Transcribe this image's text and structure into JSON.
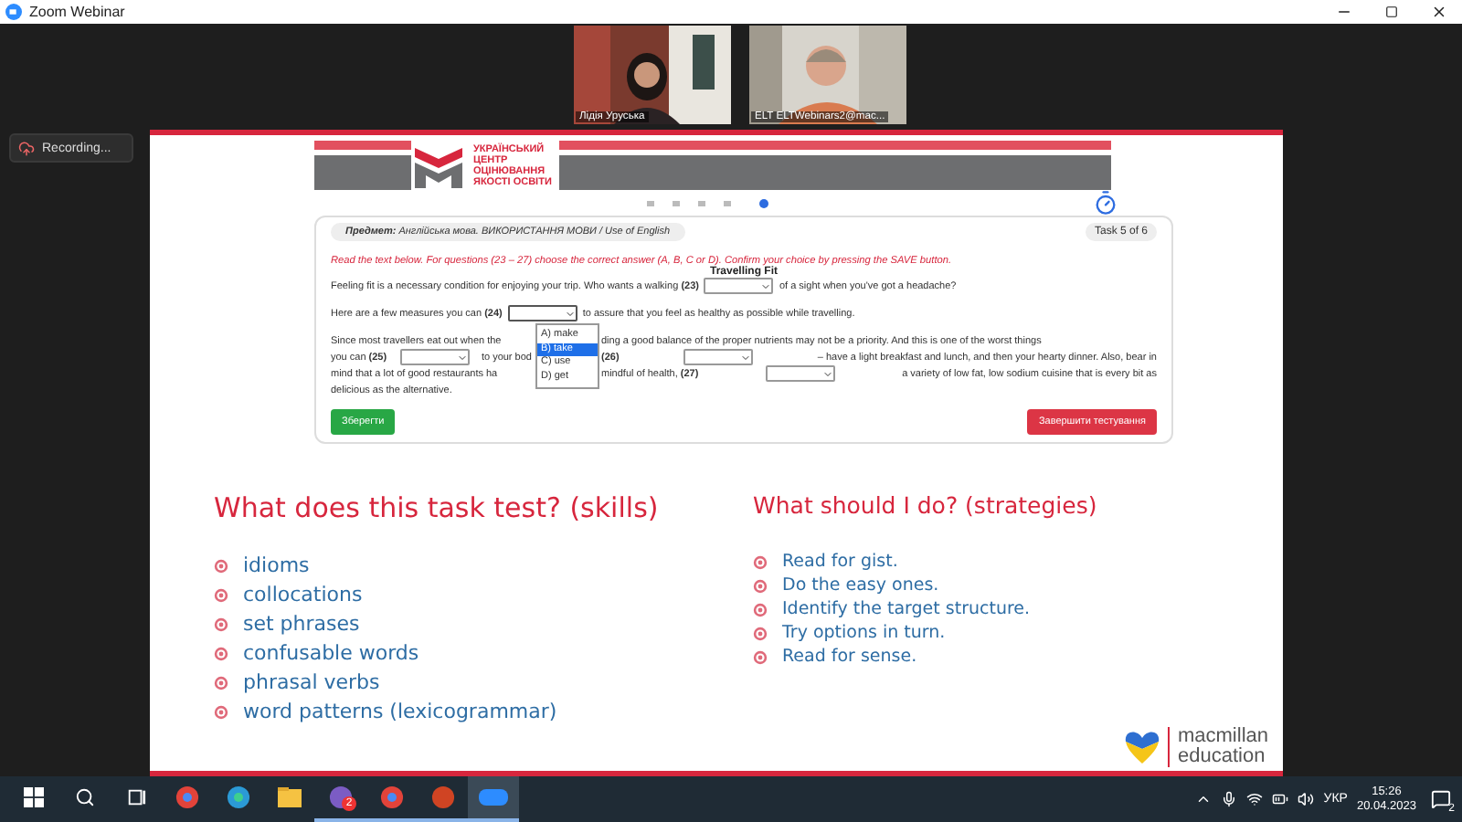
{
  "window": {
    "title": "Zoom Webinar"
  },
  "participants": [
    {
      "name": "Лідія Уруська"
    },
    {
      "name": "ELT ELTWebinars2@mac..."
    }
  ],
  "recording": {
    "label": "Recording..."
  },
  "slide": {
    "logo_lines": [
      "УКРАЇНСЬКИЙ",
      "ЦЕНТР",
      "ОЦІНЮВАННЯ",
      "ЯКОСТІ ОСВІТИ"
    ],
    "test": {
      "subject": "**Предмет:** Англійська мова. ВИКОРИСТАННЯ МОВИ / Use of English",
      "counter": "Task 5 of 6",
      "instruction": "Read the text below. For questions (23 – 27) choose the correct answer (A, B, C or D). Confirm your choice by pressing the SAVE button.",
      "heading": "Travelling Fit",
      "paragraphs": [
        [
          {
            "kind": "text",
            "text": "Feeling fit is a necessary condition for enjoying your trip. Who wants a walking **(23)**"
          },
          {
            "kind": "select",
            "open": false
          },
          {
            "kind": "text",
            "text": "of a sight when you've got a headache?"
          }
        ],
        [
          {
            "kind": "text",
            "text": "Here are a few measures you can **(24)**"
          },
          {
            "kind": "select",
            "open": true,
            "options": [
              {
                "label": "A) make",
                "selected": false
              },
              {
                "label": "B) take",
                "selected": true
              },
              {
                "label": "C) use",
                "selected": false
              },
              {
                "label": "D) get",
                "selected": false
              }
            ]
          },
          {
            "kind": "text",
            "text": "to assure that you feel as healthy as possible while travelling."
          }
        ]
      ],
      "covered_paragraph": [
        {
          "before": [
            {
              "kind": "text",
              "text": "Since most travellers eat out when the"
            }
          ],
          "after": [
            {
              "kind": "text",
              "text": "ding a good balance of the proper nutrients may not be a priority. And this is one of the worst things"
            }
          ]
        },
        {
          "before": [
            {
              "kind": "text",
              "text": "you can **(25)**"
            },
            {
              "kind": "select",
              "open": false
            },
            {
              "kind": "text",
              "text": "to your bod"
            }
          ],
          "after": [
            {
              "kind": "text",
              "text": "**(26)**"
            },
            {
              "kind": "select",
              "open": false
            },
            {
              "kind": "text",
              "text": "– have a light breakfast and lunch, and then your hearty dinner. Also, bear in"
            }
          ]
        },
        {
          "before": [
            {
              "kind": "text",
              "text": "mind that a lot of good restaurants ha"
            }
          ],
          "after": [
            {
              "kind": "text",
              "text": "mindful of health, **(27)**"
            },
            {
              "kind": "select",
              "open": false
            },
            {
              "kind": "text",
              "text": "a variety of low fat, low sodium cuisine that is every bit as"
            }
          ]
        },
        {
          "before": [
            {
              "kind": "text",
              "text": "delicious as the alternative."
            }
          ]
        }
      ],
      "save_button": "Зберегти",
      "finish_button": "Завершити тестування"
    },
    "skills": {
      "title": "What does this task test? (skills)",
      "items": [
        "idioms",
        "collocations",
        "set phrases",
        "confusable words",
        "phrasal verbs",
        "word patterns (lexicogrammar)"
      ]
    },
    "strategies": {
      "title": "What should I do? (strategies)",
      "items": [
        "Read for gist.",
        "Do the easy ones.",
        "Identify the target structure.",
        "Try options in turn.",
        "Read for sense."
      ]
    },
    "brand": [
      "macmillan",
      "education"
    ]
  },
  "taskbar": {
    "apps": [
      {
        "kind": "start",
        "running": false,
        "active": false
      },
      {
        "kind": "search",
        "running": false,
        "active": false
      },
      {
        "kind": "taskview",
        "running": false,
        "active": false
      },
      {
        "kind": "chrome",
        "running": false,
        "active": false
      },
      {
        "kind": "edge",
        "running": false,
        "active": false
      },
      {
        "kind": "folder",
        "running": false,
        "active": false
      },
      {
        "kind": "viber",
        "running": true,
        "active": false,
        "badge": "2"
      },
      {
        "kind": "chrome",
        "running": true,
        "active": false
      },
      {
        "kind": "powerpoint",
        "running": true,
        "active": false
      },
      {
        "kind": "zoom",
        "running": true,
        "active": true
      }
    ],
    "language": "УКР",
    "time": "15:26",
    "date": "20.04.2023",
    "notifications": "2"
  }
}
